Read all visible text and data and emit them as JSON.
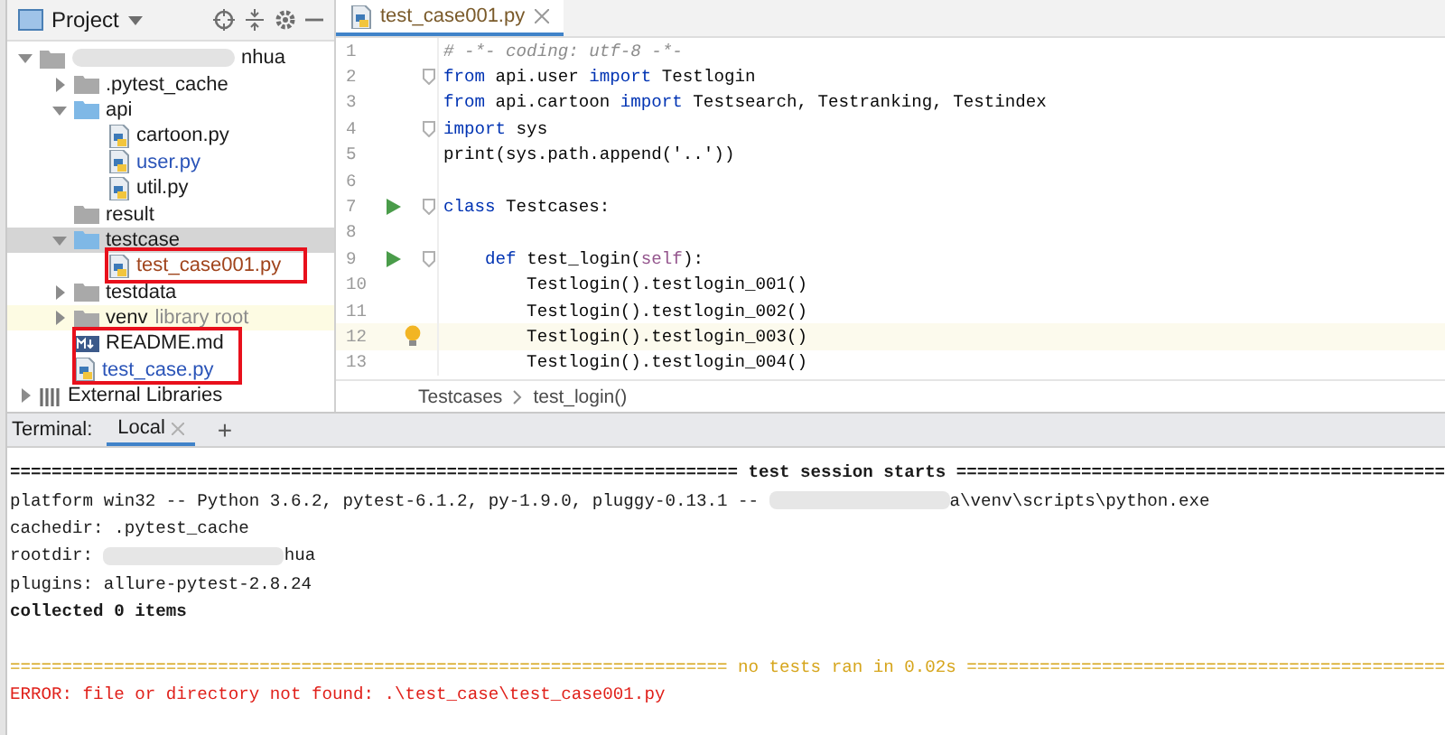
{
  "project_panel": {
    "title": "Project",
    "tree": [
      {
        "label": "nhua",
        "kind": "folder",
        "redacted": true,
        "expanded": true,
        "selected": false,
        "highlighted": false,
        "color": "#1a1a1a",
        "children": [
          {
            "label": ".pytest_cache",
            "kind": "folder",
            "expanded": false,
            "selected": false,
            "highlighted": false,
            "color": "#1a1a1a"
          },
          {
            "label": "api",
            "kind": "package",
            "expanded": true,
            "selected": false,
            "highlighted": false,
            "color": "#1a1a1a",
            "children": [
              {
                "label": "cartoon.py",
                "kind": "python",
                "selected": false,
                "highlighted": false,
                "color": "#1a1a1a"
              },
              {
                "label": "user.py",
                "kind": "python",
                "selected": false,
                "highlighted": false,
                "color": "#2a54b8"
              },
              {
                "label": "util.py",
                "kind": "python",
                "selected": false,
                "highlighted": false,
                "color": "#1a1a1a"
              }
            ]
          },
          {
            "label": "result",
            "kind": "folder",
            "selected": false,
            "highlighted": false,
            "color": "#1a1a1a"
          },
          {
            "label": "testcase",
            "kind": "package",
            "expanded": true,
            "selected": true,
            "highlighted": false,
            "color": "#1a1a1a",
            "children": [
              {
                "label": "test_case001.py",
                "kind": "python",
                "selected": false,
                "highlighted": false,
                "color": "#a0441c"
              }
            ]
          },
          {
            "label": "testdata",
            "kind": "folder",
            "expanded": false,
            "selected": false,
            "highlighted": false,
            "color": "#1a1a1a"
          },
          {
            "label": "venv",
            "hint": "library root",
            "kind": "folder",
            "expanded": false,
            "selected": false,
            "highlighted": true,
            "color": "#1a1a1a"
          },
          {
            "label": "README.md",
            "kind": "markdown",
            "selected": false,
            "highlighted": false,
            "color": "#1a1a1a"
          },
          {
            "label": "test_case.py",
            "kind": "python",
            "selected": false,
            "highlighted": false,
            "color": "#2a54b8"
          }
        ]
      },
      {
        "label": "External Libraries",
        "kind": "library",
        "expanded": false,
        "selected": false,
        "highlighted": false,
        "color": "#1a1a1a"
      }
    ]
  },
  "editor": {
    "tab": {
      "label": "test_case001.py",
      "selected": true
    },
    "lines": [
      {
        "no": "1",
        "tokens": [
          {
            "t": "# -*- coding: utf-8 -*-",
            "kind": "comment"
          }
        ]
      },
      {
        "no": "2",
        "fold": true,
        "tokens": [
          {
            "t": "from",
            "kind": "kw"
          },
          {
            "t": " api.user ",
            "kind": "plain"
          },
          {
            "t": "import",
            "kind": "kw"
          },
          {
            "t": " Testlogin",
            "kind": "plain"
          }
        ]
      },
      {
        "no": "3",
        "tokens": [
          {
            "t": "from",
            "kind": "kw"
          },
          {
            "t": " api.cartoon ",
            "kind": "plain"
          },
          {
            "t": "import",
            "kind": "kw"
          },
          {
            "t": " Testsearch, Testranking, Testindex",
            "kind": "plain"
          }
        ]
      },
      {
        "no": "4",
        "fold": true,
        "tokens": [
          {
            "t": "import",
            "kind": "kw"
          },
          {
            "t": " sys",
            "kind": "plain"
          }
        ]
      },
      {
        "no": "5",
        "tokens": [
          {
            "t": "print(sys.path.append('..'))",
            "kind": "plain"
          }
        ]
      },
      {
        "no": "6"
      },
      {
        "no": "7",
        "run": true,
        "fold": true,
        "tokens": [
          {
            "t": "class",
            "kind": "kw"
          },
          {
            "t": " Testcases:",
            "kind": "plain"
          }
        ]
      },
      {
        "no": "8"
      },
      {
        "no": "9",
        "run": true,
        "fold": true,
        "tokens": [
          {
            "t": "    def",
            "kind": "kw"
          },
          {
            "t": " test_login(",
            "kind": "plain"
          },
          {
            "t": "self",
            "kind": "self"
          },
          {
            "t": "):",
            "kind": "plain"
          }
        ]
      },
      {
        "no": "10",
        "tokens": [
          {
            "t": "        Testlogin().testlogin_001()",
            "kind": "plain"
          }
        ]
      },
      {
        "no": "11",
        "tokens": [
          {
            "t": "        Testlogin().testlogin_002()",
            "kind": "plain"
          }
        ]
      },
      {
        "no": "12",
        "current": true,
        "bulb": true,
        "tokens": [
          {
            "t": "        Testlogin().testlogin_003()",
            "kind": "plain"
          }
        ]
      },
      {
        "no": "13",
        "tokens": [
          {
            "t": "        Testlogin().testlogin_004()",
            "kind": "plain"
          }
        ]
      }
    ],
    "breadcrumb": [
      "Testcases",
      "test_login()"
    ]
  },
  "terminal": {
    "label": "Terminal:",
    "tabs": [
      {
        "label": "Local",
        "selected": true
      }
    ],
    "add": "+",
    "lines": [
      {
        "kind": "header",
        "text": "====================================================================== test session starts ==============================================="
      },
      {
        "kind": "redacted",
        "before": "platform win32 -- Python 3.6.2, pytest-6.1.2, py-1.9.0, pluggy-0.13.1 -- ",
        "after": "a\\venv\\scripts\\python.exe"
      },
      {
        "kind": "plain",
        "text": "cachedir: .pytest_cache"
      },
      {
        "kind": "redacted",
        "before": "rootdir: ",
        "after": "hua"
      },
      {
        "kind": "plain",
        "text": "plugins: allure-pytest-2.8.24"
      },
      {
        "kind": "bold",
        "text": "collected 0 items"
      },
      {
        "kind": "blank"
      },
      {
        "kind": "warning",
        "text": "===================================================================== no tests ran in 0.02s =============================================="
      },
      {
        "kind": "error",
        "text": "ERROR: file or directory not found: .\\test_case\\test_case001.py"
      }
    ]
  },
  "annotations": [
    {
      "kind": "red-box"
    },
    {
      "kind": "red-box"
    }
  ]
}
